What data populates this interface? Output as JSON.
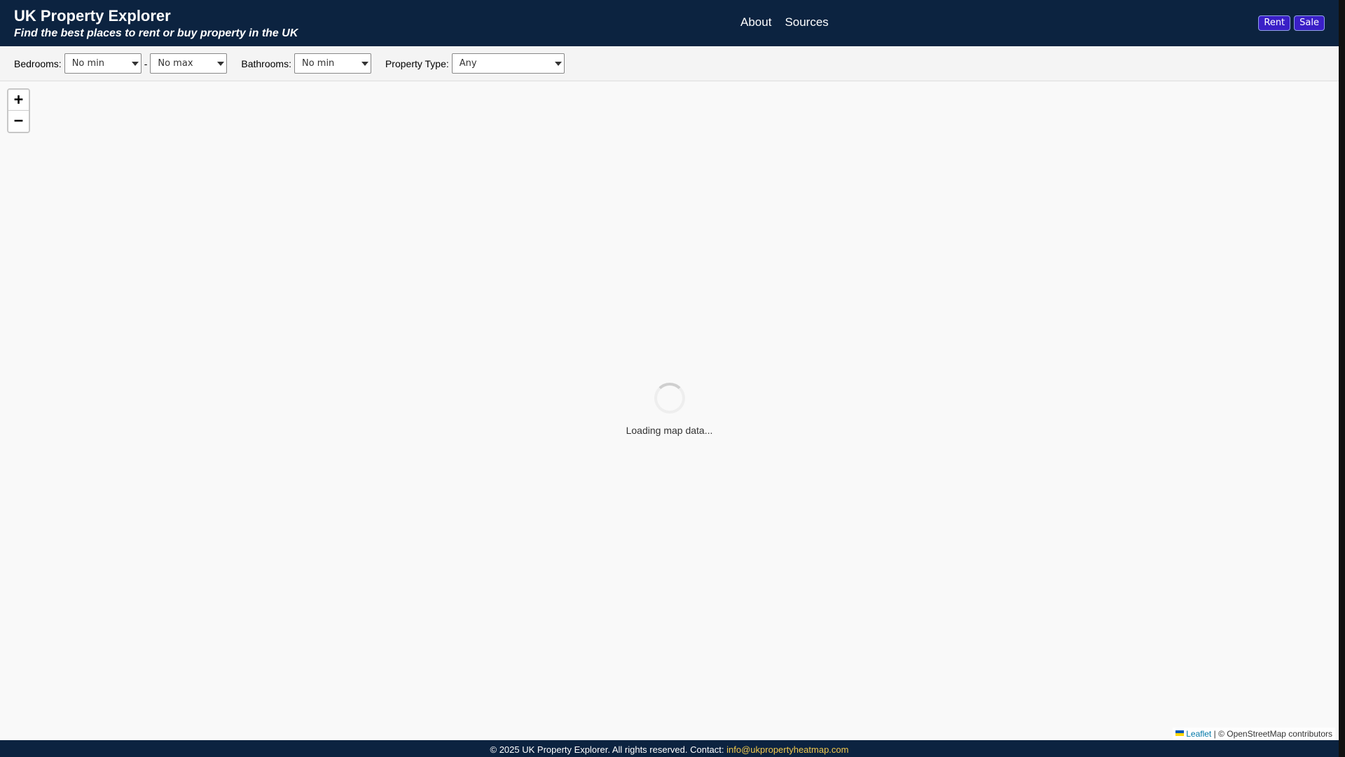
{
  "header": {
    "title": "UK Property Explorer",
    "subtitle": "Find the best places to rent or buy property in the UK",
    "nav": {
      "about": "About",
      "sources": "Sources"
    },
    "mode": {
      "rent": "Rent",
      "sale": "Sale"
    }
  },
  "filters": {
    "bedrooms_label": "Bedrooms:",
    "bedrooms_min": "No min",
    "range_separator": "-",
    "bedrooms_max": "No max",
    "bathrooms_label": "Bathrooms:",
    "bathrooms_min": "No min",
    "property_type_label": "Property Type:",
    "property_type": "Any"
  },
  "map": {
    "zoom_in": "+",
    "zoom_out": "−",
    "loading_text": "Loading map data...",
    "attribution": {
      "leaflet": "Leaflet",
      "separator": "|",
      "osm": "© OpenStreetMap contributors"
    }
  },
  "footer": {
    "text": "© 2025 UK Property Explorer. All rights reserved. Contact:",
    "email": "info@ukpropertyheatmap.com"
  }
}
